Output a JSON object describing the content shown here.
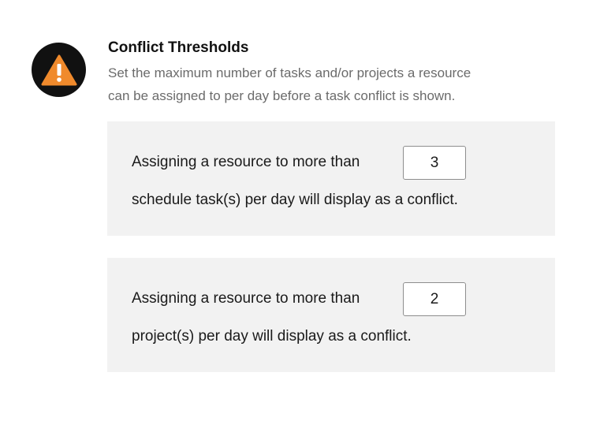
{
  "section": {
    "icon": "warning-triangle-icon",
    "title": "Conflict Thresholds",
    "description_line1": "Set the maximum number of tasks and/or projects a resource",
    "description_line2": "can be assigned to per day before a task conflict is shown."
  },
  "task_threshold": {
    "prefix": "Assigning a resource to more than",
    "value": "3",
    "suffix": "schedule task(s) per day will display as a conflict."
  },
  "project_threshold": {
    "prefix": "Assigning a resource to more than",
    "value": "2",
    "suffix": "project(s) per day will display as a conflict."
  },
  "colors": {
    "icon_background": "#111111",
    "warning_orange": "#f08a2c",
    "panel_background": "#f2f2f2",
    "description_text": "#6b6b6b"
  }
}
